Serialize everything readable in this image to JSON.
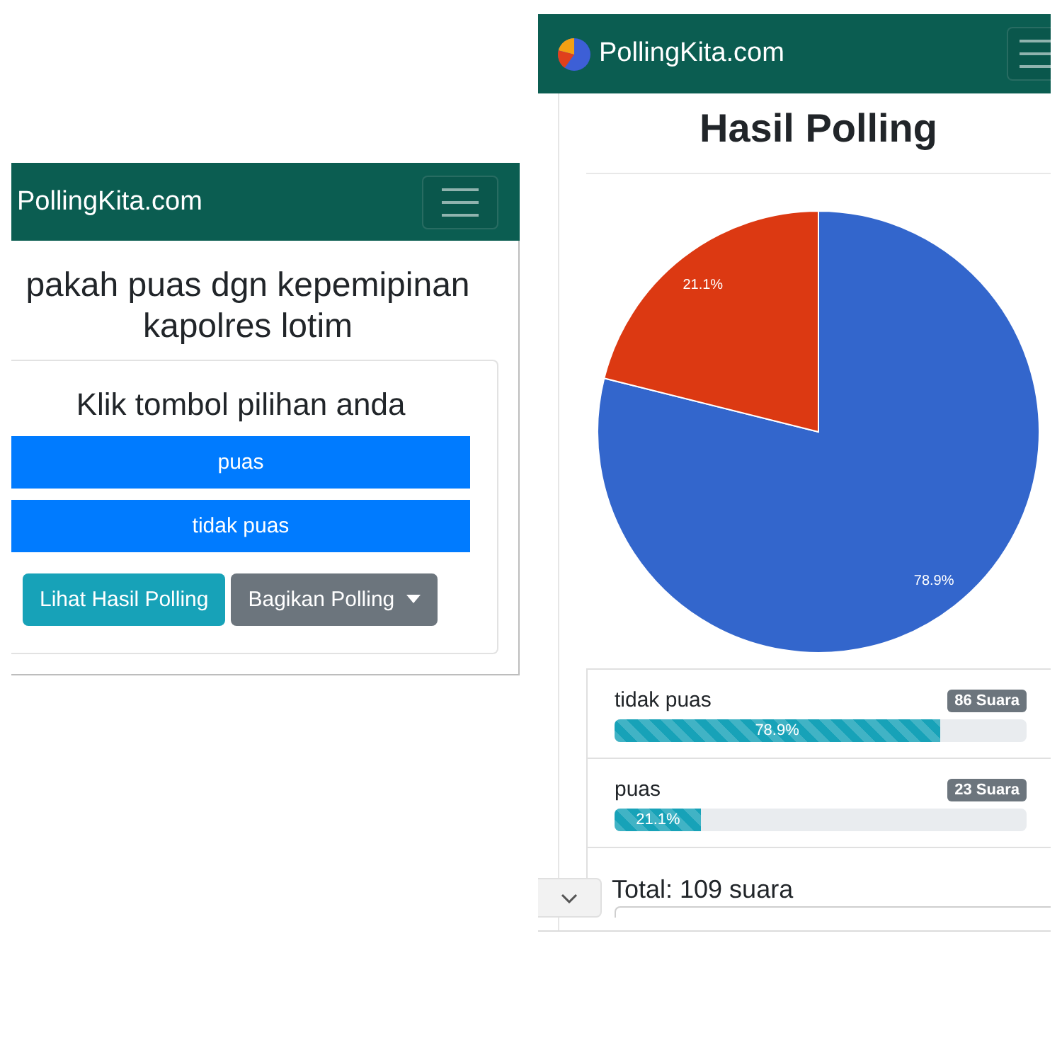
{
  "left_screen": {
    "navbar": {
      "brand": "PollingKita.com"
    },
    "question": "pakah puas dgn kepemipinan kapolres lotim",
    "card": {
      "heading": "Klik tombol pilihan anda",
      "options": [
        {
          "label": "puas"
        },
        {
          "label": "tidak puas"
        }
      ],
      "actions": [
        {
          "kind": "info",
          "label": "Lihat Hasil Polling"
        },
        {
          "kind": "dropdown",
          "label": "Bagikan Polling"
        }
      ]
    }
  },
  "right_screen": {
    "navbar": {
      "brand": "PollingKita.com"
    },
    "title": "Hasil Polling",
    "chart_data": {
      "type": "pie",
      "values": [
        78.9,
        21.1
      ],
      "colors": [
        "#3366cc",
        "#dc3912"
      ],
      "value_labels": [
        "78.9%",
        "21.1%"
      ]
    },
    "results": [
      {
        "label": "tidak puas",
        "votes": "86 Suara",
        "level": 0.789,
        "percent": "78.9%"
      },
      {
        "label": "puas",
        "votes": "23 Suara",
        "level": 0.211,
        "percent": "21.1%"
      }
    ],
    "total": "Total: 109 suara"
  }
}
